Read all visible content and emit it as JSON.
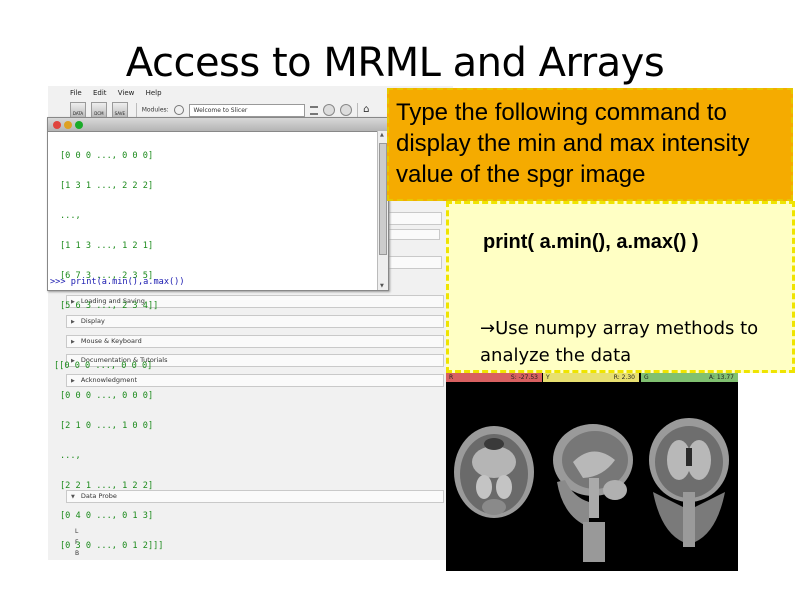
{
  "slide": {
    "title": "Access to MRML and Arrays"
  },
  "menu": [
    "File",
    "Edit",
    "View",
    "Help"
  ],
  "toolbar": {
    "buttons": [
      "DATA",
      "DCM",
      "SAVE"
    ],
    "modules_label": "Modules:",
    "module_selected": "Welcome to Slicer"
  },
  "console": {
    "lines": [
      "[0 0 0 ..., 0 0 0]",
      "[1 3 1 ..., 2 2 2]",
      "...,",
      "[1 1 3 ..., 1 2 1]",
      "[6 7 3 ..., 2 3 5]",
      "[5 6 3 ..., 2 3 4]]",
      "",
      "[[0 0 0 ..., 0 0 0]",
      "[0 0 0 ..., 0 0 0]",
      "[2 1 0 ..., 1 0 0]",
      "...,",
      "[2 2 1 ..., 1 2 2]",
      "[0 4 0 ..., 0 1 3]",
      "[0 3 0 ..., 0 1 2]]]"
    ],
    "prompt": ">>> print(a.min(),a.max())"
  },
  "panels": [
    {
      "label": "Loading and Saving"
    },
    {
      "label": "Display"
    },
    {
      "label": "Mouse & Keyboard"
    },
    {
      "label": "Documentation & Tutorials"
    },
    {
      "label": "Acknowledgment"
    },
    {
      "label": "Data Probe"
    }
  ],
  "side_field_text": "Data",
  "probe_labels": [
    "L",
    "F",
    "B"
  ],
  "callout_instruction": "Type the following command to display the min and max intensity value of the spgr image",
  "callout_command": "print( a.min(), a.max() )",
  "callout_note": "→Use numpy array methods to analyze the data",
  "viewers": [
    {
      "letter": "R",
      "value": "S: -27.53",
      "color": "#d86060"
    },
    {
      "letter": "Y",
      "value": "R: 2.30",
      "color": "#e8e070"
    },
    {
      "letter": "G",
      "value": "A: 13.77",
      "color": "#80c070"
    }
  ],
  "colors": {
    "callout_orange": "#f5ab00",
    "callout_yellow": "#ffffc4",
    "dash_yellow": "#efe400"
  }
}
